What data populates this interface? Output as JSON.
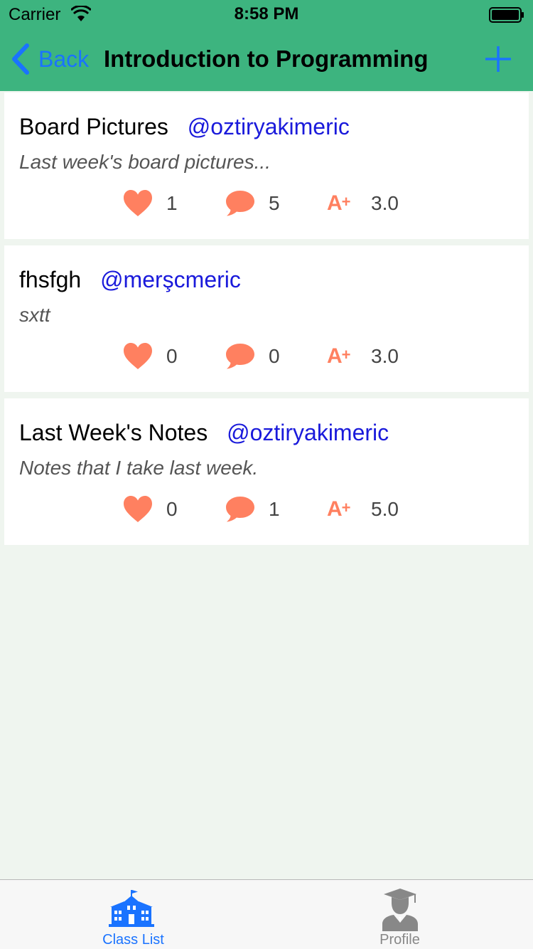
{
  "status_bar": {
    "carrier": "Carrier",
    "time": "8:58 PM"
  },
  "nav": {
    "back_label": "Back",
    "title": "Introduction to Programming",
    "add_icon": "plus-icon"
  },
  "posts": [
    {
      "title": "Board Pictures",
      "author": "@oztiryakimeric",
      "description": "Last week's board pictures...",
      "likes": "1",
      "comments": "5",
      "grade": "3.0"
    },
    {
      "title": "fhsfgh",
      "author": "@merşcmeric",
      "description": "sxtt",
      "likes": "0",
      "comments": "0",
      "grade": "3.0"
    },
    {
      "title": "Last Week's Notes",
      "author": "@oztiryakimeric",
      "description": "Notes that I take last week.",
      "likes": "0",
      "comments": "1",
      "grade": "5.0"
    }
  ],
  "icons": {
    "like": "heart-icon",
    "comment": "speech-bubble-icon",
    "grade": "a-plus-icon"
  },
  "grade_badge": {
    "letter": "A",
    "plus": "+"
  },
  "tabbar": {
    "items": [
      {
        "label": "Class List",
        "icon": "school-building-icon",
        "selected": true
      },
      {
        "label": "Profile",
        "icon": "graduate-icon",
        "selected": false
      }
    ]
  },
  "colors": {
    "nav_bar": "#3db47f",
    "accent": "#1a73ff",
    "author": "#1a1adb",
    "stat_icon": "#ff8060",
    "background": "#eff5ef"
  }
}
